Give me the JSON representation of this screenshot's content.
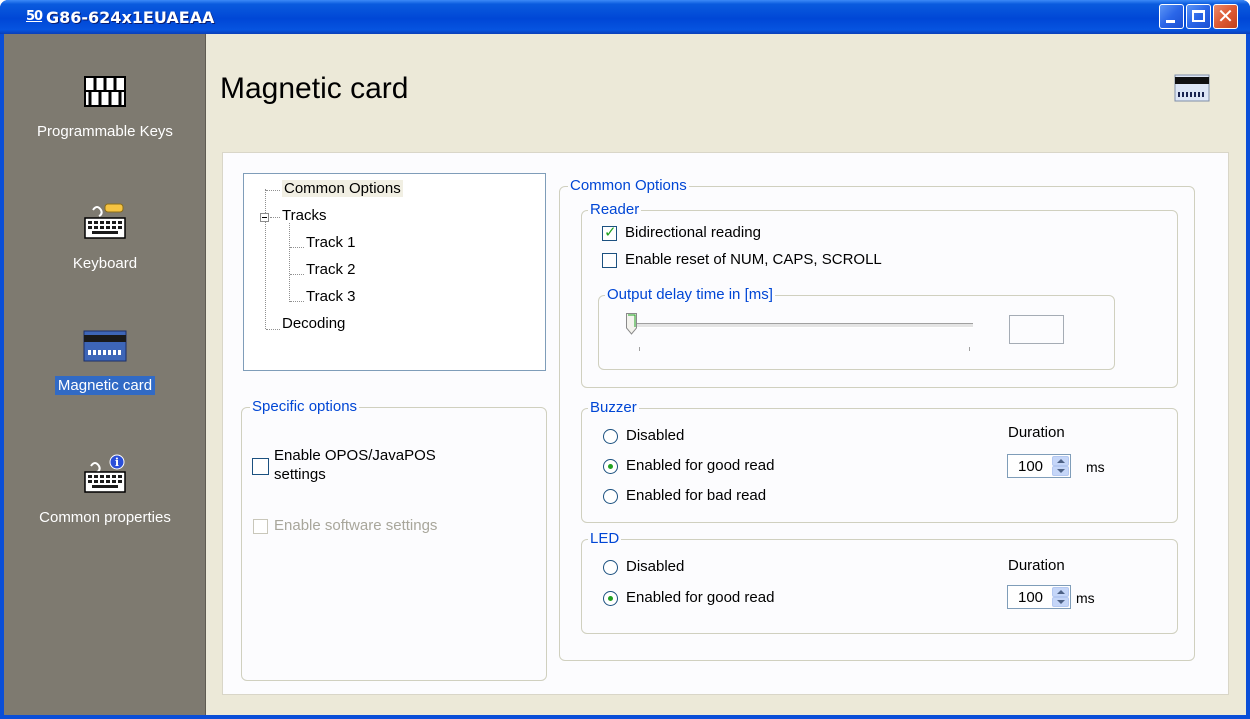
{
  "window": {
    "title": "G86-624x1EUAEAA",
    "app_icon_glyph": "50"
  },
  "sidebar": {
    "items": [
      {
        "label": "Programmable Keys",
        "icon": "programmable-keys-icon",
        "selected": false
      },
      {
        "label": "Keyboard",
        "icon": "keyboard-tools-icon",
        "selected": false
      },
      {
        "label": "Magnetic card",
        "icon": "magnetic-card-icon",
        "selected": true
      },
      {
        "label": "Common properties",
        "icon": "keyboard-info-icon",
        "selected": false
      }
    ]
  },
  "page": {
    "title": "Magnetic card",
    "header_icon": "magnetic-card-reader-icon"
  },
  "tree": {
    "items": [
      {
        "label": "Common Options",
        "selected": true
      },
      {
        "label": "Tracks",
        "expanded": true
      },
      {
        "label": "Track 1"
      },
      {
        "label": "Track 2"
      },
      {
        "label": "Track 3"
      },
      {
        "label": "Decoding"
      }
    ]
  },
  "specific": {
    "title": "Specific options",
    "opos_label": "Enable OPOS/JavaPOS settings",
    "opos_label_line1": "Enable OPOS/JavaPOS",
    "opos_label_line2": "settings",
    "opos_checked": false,
    "software_label": "Enable software settings",
    "software_checked": false,
    "software_enabled": false
  },
  "common": {
    "title": "Common Options",
    "reader": {
      "title": "Reader",
      "bidirectional_label": "Bidirectional reading",
      "bidirectional_checked": true,
      "reset_label": "Enable reset of NUM, CAPS, SCROLL",
      "reset_checked": false,
      "delay": {
        "title": "Output delay time in [ms]",
        "slider_value": 0,
        "value_text": ""
      }
    },
    "buzzer": {
      "title": "Buzzer",
      "options": [
        "Disabled",
        "Enabled for good read",
        "Enabled for bad read"
      ],
      "selected": "Enabled for good read",
      "duration_label": "Duration",
      "duration_value": "100",
      "unit": "ms"
    },
    "led": {
      "title": "LED",
      "options": [
        "Disabled",
        "Enabled for good read"
      ],
      "selected": "Enabled for good read",
      "duration_label": "Duration",
      "duration_value": "100",
      "unit": "ms"
    }
  },
  "colors": {
    "titlebar": "#0047d6",
    "sidebar": "#7e7a70",
    "selection": "#316ac5",
    "group_title": "#0046d5",
    "check_mark": "#21a121"
  }
}
